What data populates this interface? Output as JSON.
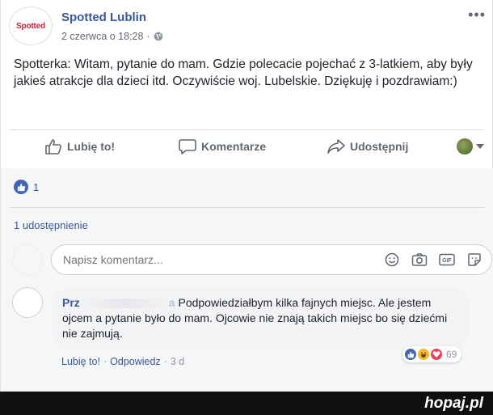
{
  "post": {
    "page_name": "Spotted Lublin",
    "logo_text": "Spotted",
    "date": "2 czerwca o 18:28",
    "more": "•••",
    "text": "Spotterka: Witam, pytanie do mam. Gdzie polecacie pojechać z 3-latkiem, aby były jakieś atrakcje dla dzieci itd. Oczywiście woj. Lubelskie. Dziękuję i pozdrawiam:)"
  },
  "actions": {
    "like": "Lubię to!",
    "comment": "Komentarze",
    "share": "Udostępnij"
  },
  "reactions": {
    "count": "1"
  },
  "shares": "1 udostępnienie",
  "comment_box": {
    "placeholder": "Napisz komentarz..."
  },
  "comment": {
    "author_visible_start": "Prz",
    "author_visible_end": "a",
    "text": "Podpowiedziałbym kilka fajnych miejsc. Ale jestem ojcem a pytanie było do mam. Ojcowie nie znają takich miejsc bo się dziećmi nie zajmują.",
    "reaction_count": "69",
    "like": "Lubię to!",
    "sep1": "·",
    "reply": "Odpowiedz",
    "sep2": "·",
    "time": "3 d"
  },
  "watermark": {
    "brand": "hopaj",
    "tld": ".pl"
  },
  "colors": {
    "link": "#365899",
    "like_blue": "#4267b2",
    "footer": "#101010"
  }
}
